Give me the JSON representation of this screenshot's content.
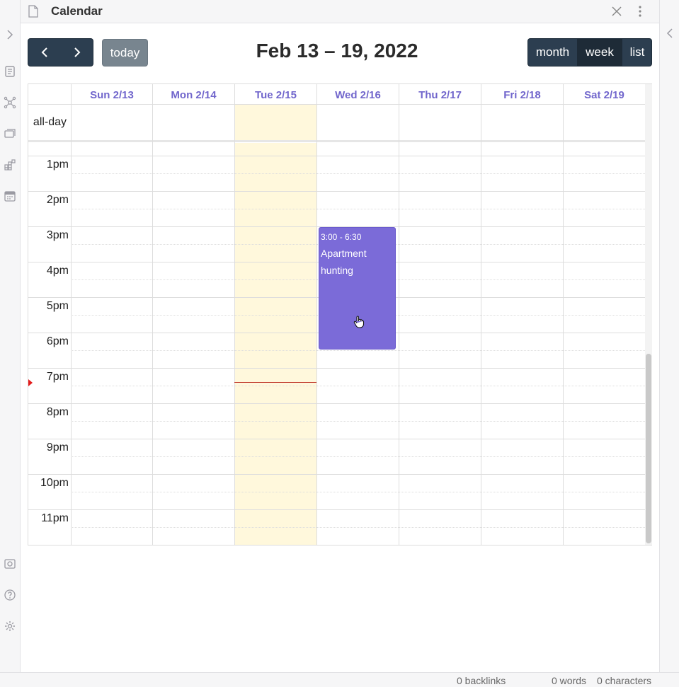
{
  "window": {
    "title": "Calendar"
  },
  "toolbar": {
    "prev_icon": "chevron-left-icon",
    "next_icon": "chevron-right-icon",
    "today_label": "today",
    "range_title": "Feb 13 – 19, 2022",
    "views": {
      "month": "month",
      "week": "week",
      "list": "list"
    },
    "active_view": "week"
  },
  "calendar": {
    "all_day_label": "all-day",
    "days": [
      "Sun 2/13",
      "Mon 2/14",
      "Tue 2/15",
      "Wed 2/16",
      "Thu 2/17",
      "Fri 2/18",
      "Sat 2/19"
    ],
    "today": "Tue 2/15",
    "time_labels": [
      "1pm",
      "2pm",
      "3pm",
      "4pm",
      "5pm",
      "6pm",
      "7pm",
      "8pm",
      "9pm",
      "10pm",
      "11pm"
    ],
    "now_time": "7:10pm",
    "events": [
      {
        "time": "3:00 - 6:30",
        "title": "Apartment hunting",
        "day": "Wed 2/16",
        "color": "#7b6bd8"
      }
    ]
  },
  "status": {
    "backlinks": "0 backlinks",
    "words": "0 words",
    "characters": "0 characters"
  },
  "colors": {
    "accent": "#7166cc",
    "button_dark": "#2c3e50",
    "today_bg": "#fff8dc",
    "now_indicator": "#e31c1c"
  }
}
